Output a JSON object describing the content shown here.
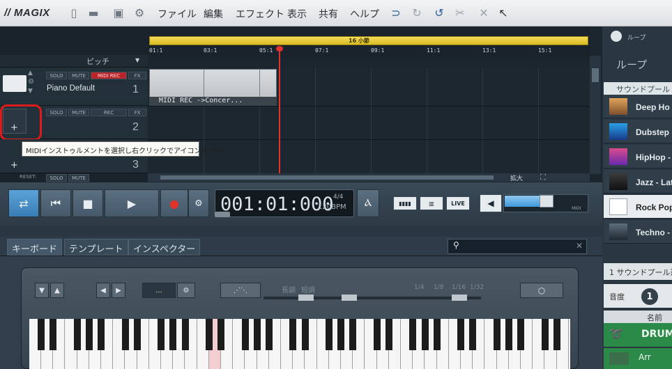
{
  "menubar": {
    "logo": "// MAGIX",
    "menus": [
      "ファイル",
      "編集",
      "エフェクト",
      "表示",
      "共有",
      "ヘルプ"
    ]
  },
  "arranger": {
    "pitch_label": "ピッチ",
    "loop_count": "16 小節",
    "ruler": [
      "01:1",
      "03:1",
      "05:1",
      "07:1",
      "09:1",
      "11:1",
      "13:1",
      "15:1"
    ],
    "tracks": [
      {
        "solo": "SOLO",
        "mute": "MUTE",
        "rec": "MIDI REC",
        "fx": "FX",
        "name": "Piano Default",
        "number": "1"
      },
      {
        "solo": "SOLO",
        "mute": "MUTE",
        "rec": "REC",
        "fx": "FX",
        "name": "",
        "number": "2"
      },
      {
        "solo": "SOLO",
        "mute": "MUTE",
        "rec": "",
        "fx": "",
        "name": "",
        "number": "3"
      }
    ],
    "reset_label": "RESET:",
    "clip_label": "MIDI REC ->Concer...",
    "tooltip": "MIDIインストゥルメントを選択し右クリックでアイコンを変更",
    "zoom_label": "拡大"
  },
  "transport": {
    "time": "001:01:000",
    "bpm": "120BPM",
    "meter": "4/4",
    "live_label": "LIVE",
    "midi_label": "MIDI"
  },
  "lower": {
    "tabs": [
      "キーボード",
      "テンプレート",
      "インスペクター"
    ],
    "search_placeholder": "",
    "scale_labels": [
      "長調",
      "短調"
    ],
    "note_values": [
      "1/4",
      "1/8",
      "1/16",
      "1/32"
    ],
    "dropdown_value": "..."
  },
  "sidebar": {
    "header_small": "ループ",
    "header": "ループ",
    "pool_label": "サウンドプール",
    "items": [
      "Deep Ho",
      "Dubstep",
      "HipHop -",
      "Jazz - Lat",
      "Rock Pop",
      "Techno -"
    ],
    "footer": "1 サウンドプール選",
    "tempo_label": "音度",
    "tempo_value": "1",
    "name_header": "名前",
    "rows": [
      "DRUM",
      "Arr"
    ]
  },
  "colors": {
    "accent": "#3f98da",
    "loop": "#e5c834",
    "record": "#e0332b",
    "highlight": "#e01a1a"
  }
}
